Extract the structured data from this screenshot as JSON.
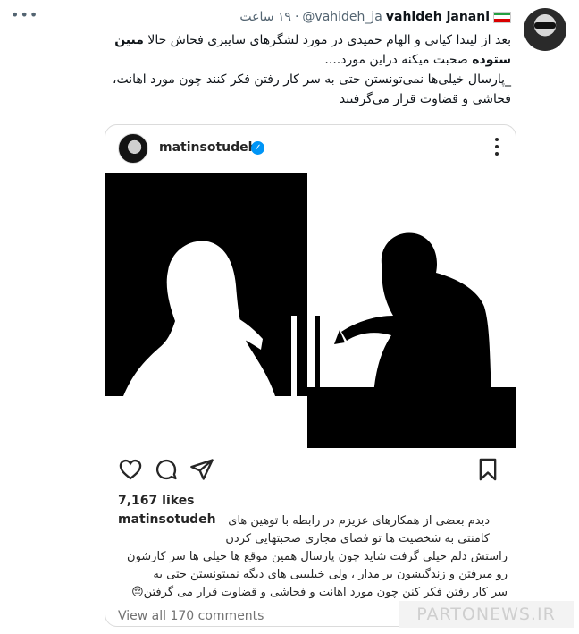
{
  "tweet": {
    "display_name": "vahideh janani",
    "handle": "@vahideh_ja",
    "separator": "·",
    "time": "۱۹ ساعت",
    "more_icon": "ellipsis-icon",
    "flag_colors": [
      "#239f40",
      "#ffffff",
      "#da0000"
    ],
    "text": {
      "line1": "بعد از لیندا کیانی و الهام حمیدی در مورد لشگرهای سایبری فحاش حالا",
      "line1_bold": "متین",
      "line2_bold": "ستوده",
      "line2": "صحبت میکنه دراین مورد....",
      "line3": "_پارسال خیلی‌ها نمی‌تونستن حتی به سر کار رفتن فکر کنند چون مورد اهانت،",
      "line4": "فحاشی و قضاوت قرار می‌گرفتند"
    }
  },
  "instagram": {
    "username": "matinsotudeh",
    "verified_icon": "verified-badge-icon",
    "likes": "7,167 likes",
    "caption_user": "matinsotudeh",
    "caption": {
      "l1": "دیدم بعضی از همکارهای عزیزم در رابطه با توهین های",
      "l2": "کامنتی به شخصیت ها تو فضای مجازی صحبتهایی کردن",
      "l3": "راستش دلم خیلی گرفت شاید چون پارسال همین موقع ها خیلی ها سر کارشون",
      "l4": "رو میرفتن و زندگیشون بر مدار ، ولی خیلیییی های دیگه نمیتونستن حتی به",
      "l5": "سر کار رفتن فکر کنن چون مورد اهانت و فحاشی و قضاوت قرار می گرفتن😔"
    },
    "view_all": "View all 170 comments",
    "action_icons": [
      "heart-icon",
      "comment-icon",
      "share-icon",
      "bookmark-icon"
    ]
  },
  "watermark": "PARTONEWS.IR"
}
